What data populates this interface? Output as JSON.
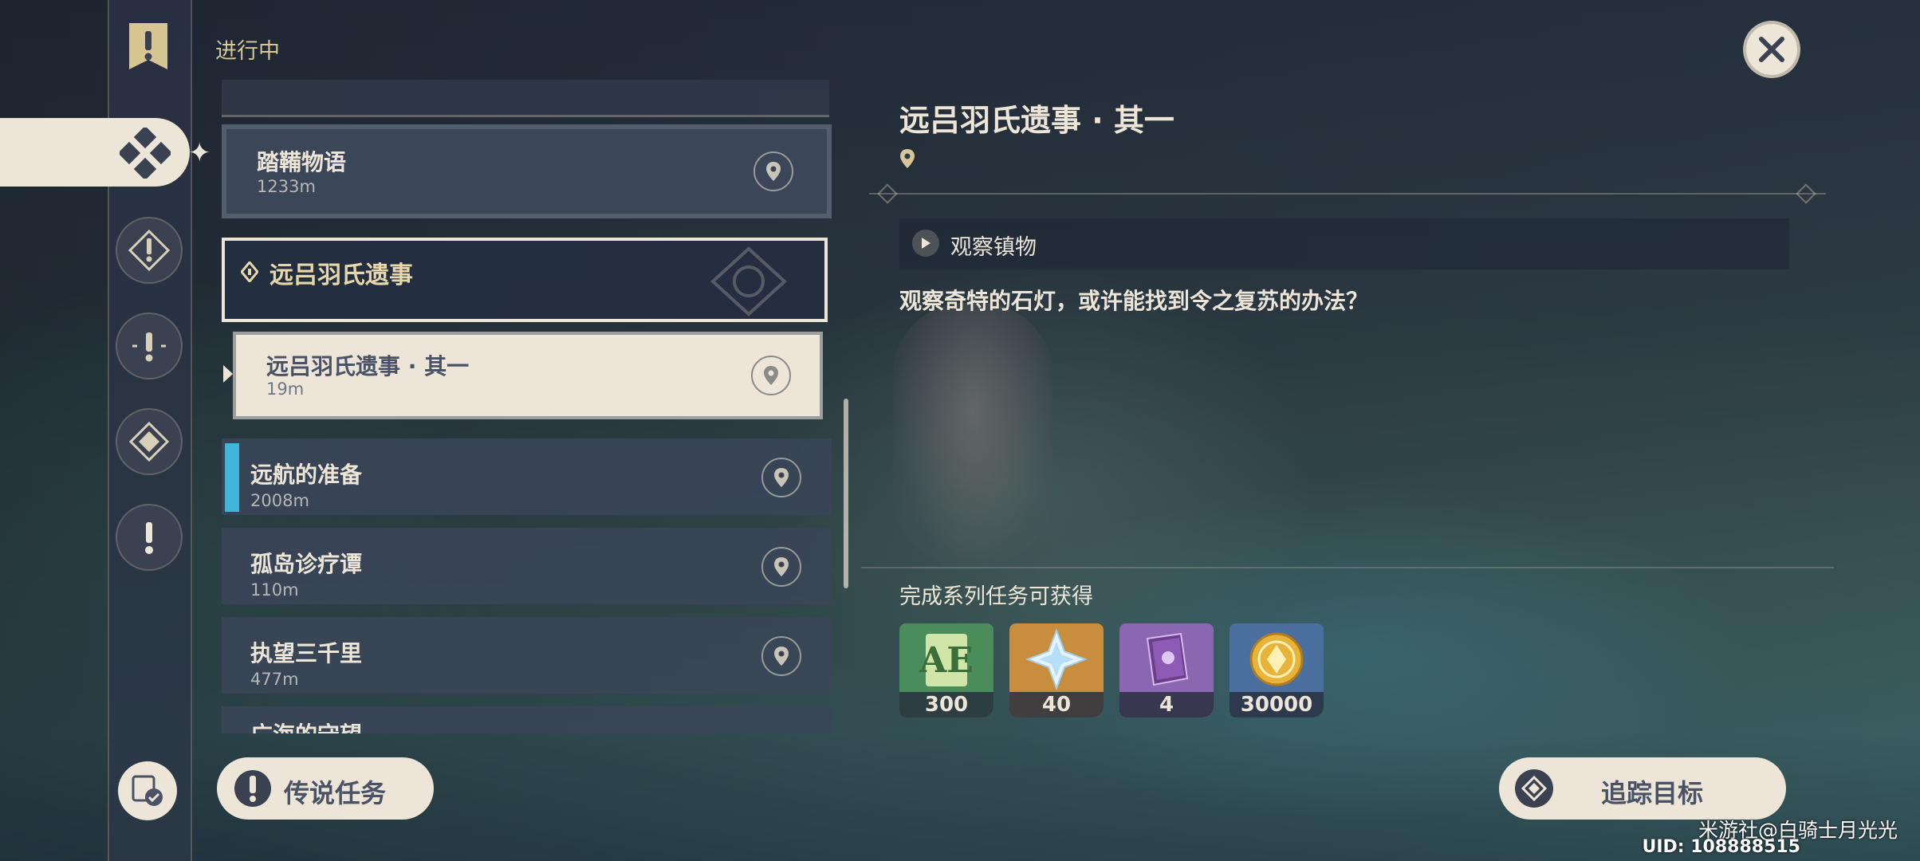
{
  "header": {
    "status": "进行中"
  },
  "sidebar": {
    "icons": [
      "quest-banner-icon",
      "all-quests-icon",
      "archon-quest-icon",
      "story-quest-icon",
      "world-quest-icon",
      "legend-quest-icon",
      "commission-icon"
    ]
  },
  "quest_list": {
    "items": [
      {
        "title": "踏鞴物语",
        "distance": "1233m"
      },
      {
        "title": "远吕羽氏遗事",
        "group": true
      },
      {
        "title": "远吕羽氏遗事 · 其一",
        "distance": "19m",
        "selected": true
      },
      {
        "title": "远航的准备",
        "distance": "2008m",
        "tracked": true
      },
      {
        "title": "孤岛诊疗谭",
        "distance": "110m"
      },
      {
        "title": "执望三千里",
        "distance": "477m"
      },
      {
        "title": "广海的守望",
        "distance": ""
      }
    ]
  },
  "detail": {
    "title": "远吕羽氏遗事 · 其一",
    "objective": "观察镇物",
    "description": "观察奇特的石灯，或许能找到令之复苏的办法？",
    "rewards_title": "完成系列任务可获得",
    "rewards": [
      {
        "icon": "adventure-exp-icon",
        "count": "300",
        "color": "#4a8c5a"
      },
      {
        "icon": "primogem-icon",
        "count": "40",
        "color": "#c98d3e"
      },
      {
        "icon": "heros-wit-icon",
        "count": "4",
        "color": "#8a67b0"
      },
      {
        "icon": "mora-icon",
        "count": "30000",
        "color": "#4b6f9e"
      }
    ]
  },
  "buttons": {
    "legend": "传说任务",
    "track": "追踪目标"
  },
  "watermark": {
    "text": "米游社@白骑士月光光",
    "uid": "UID: 108888515"
  }
}
